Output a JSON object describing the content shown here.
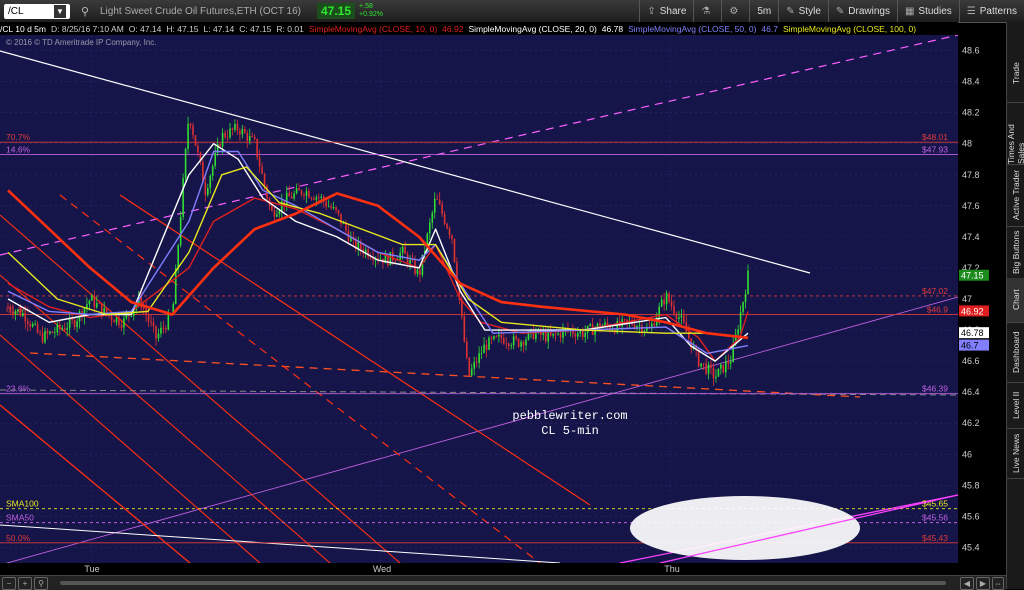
{
  "toolbar": {
    "symbol": "/CL",
    "description": "Light Sweet Crude Oil Futures,ETH (OCT 16)",
    "last": "47.15",
    "change_abs": "+.58",
    "change_pct": "+0.92%",
    "buttons": [
      {
        "icon": "share-icon",
        "glyph": "⇪",
        "label": "Share"
      },
      {
        "icon": "flask-icon",
        "glyph": "⚗",
        "label": ""
      },
      {
        "icon": "gear-icon",
        "glyph": "⚙",
        "label": ""
      },
      {
        "icon": "",
        "glyph": "",
        "label": "5m"
      },
      {
        "icon": "style-icon",
        "glyph": "✎",
        "label": "Style"
      },
      {
        "icon": "drawings-icon",
        "glyph": "✎",
        "label": "Drawings"
      },
      {
        "icon": "studies-icon",
        "glyph": "▦",
        "label": "Studies"
      },
      {
        "icon": "patterns-icon",
        "glyph": "☰",
        "label": "Patterns"
      }
    ]
  },
  "infobar": [
    {
      "text": "/CL 10 d 5m",
      "color": "#ffffff"
    },
    {
      "text": "D: 8/25/16 7:10 AM",
      "color": "#cccccc"
    },
    {
      "text": "O: 47.14",
      "color": "#cccccc"
    },
    {
      "text": "H: 47.15",
      "color": "#cccccc"
    },
    {
      "text": "L: 47.14",
      "color": "#cccccc"
    },
    {
      "text": "C: 47.15",
      "color": "#cccccc"
    },
    {
      "text": "R: 0.01",
      "color": "#cccccc"
    },
    {
      "text": "SimpleMovingAvg (CLOSE, 10, 0)",
      "color": "#e02020"
    },
    {
      "text": "46.92",
      "color": "#e02020"
    },
    {
      "text": "SimpleMovingAvg (CLOSE, 20, 0)",
      "color": "#ffffff"
    },
    {
      "text": "46.78",
      "color": "#ffffff"
    },
    {
      "text": "SimpleMovingAvg (CLOSE, 50, 0)",
      "color": "#8080ff"
    },
    {
      "text": "46.7",
      "color": "#8080ff"
    },
    {
      "text": "SimpleMovingAvg (CLOSE, 100, 0)",
      "color": "#e8e820"
    }
  ],
  "copyright": "© 2016 © TD Ameritrade IP Company, Inc.",
  "side_tabs": [
    "Trade",
    "Times And Sales",
    "Active Trader",
    "Big Buttons",
    "Chart",
    "Dashboard",
    "Level II",
    "Live News"
  ],
  "chart_data": {
    "type": "candlestick",
    "symbol": "/CL",
    "interval": "5m",
    "ylim": [
      45.3,
      48.7
    ],
    "y_ticks": [
      45.4,
      45.6,
      45.8,
      46,
      46.2,
      46.4,
      46.6,
      46.8,
      47,
      47.2,
      47.4,
      47.6,
      47.8,
      48,
      48.2,
      48.4,
      48.6
    ],
    "x_labels": [
      "Tue",
      "Wed",
      "Thu"
    ],
    "watermark": [
      "pebblewriter.com",
      "CL 5-min"
    ],
    "price_path": [
      [
        0,
        46.95
      ],
      [
        4,
        46.9
      ],
      [
        8,
        46.75
      ],
      [
        12,
        46.8
      ],
      [
        16,
        46.85
      ],
      [
        20,
        47.0
      ],
      [
        24,
        46.9
      ],
      [
        28,
        46.85
      ],
      [
        32,
        47.0
      ],
      [
        36,
        46.75
      ],
      [
        40,
        46.9
      ],
      [
        44,
        48.2
      ],
      [
        48,
        47.7
      ],
      [
        52,
        48.05
      ],
      [
        56,
        48.1
      ],
      [
        60,
        48.0
      ],
      [
        64,
        47.55
      ],
      [
        68,
        47.65
      ],
      [
        72,
        47.7
      ],
      [
        76,
        47.65
      ],
      [
        80,
        47.55
      ],
      [
        84,
        47.35
      ],
      [
        88,
        47.3
      ],
      [
        92,
        47.25
      ],
      [
        96,
        47.3
      ],
      [
        100,
        47.15
      ],
      [
        104,
        47.65
      ],
      [
        108,
        47.4
      ],
      [
        112,
        46.5
      ],
      [
        116,
        46.7
      ],
      [
        120,
        46.75
      ],
      [
        124,
        46.72
      ],
      [
        128,
        46.78
      ],
      [
        132,
        46.75
      ],
      [
        136,
        46.8
      ],
      [
        140,
        46.78
      ],
      [
        144,
        46.83
      ],
      [
        148,
        46.82
      ],
      [
        152,
        46.85
      ],
      [
        156,
        46.8
      ],
      [
        160,
        47.02
      ],
      [
        164,
        46.85
      ],
      [
        168,
        46.6
      ],
      [
        172,
        46.5
      ],
      [
        176,
        46.62
      ],
      [
        180,
        47.15
      ]
    ],
    "x_domain": [
      0,
      180
    ],
    "sma": [
      {
        "name": "SMA10",
        "color": "#e02020",
        "last": "46.92",
        "points": [
          [
            0,
            47.1
          ],
          [
            10,
            46.95
          ],
          [
            20,
            46.88
          ],
          [
            30,
            46.92
          ],
          [
            44,
            47.2
          ],
          [
            50,
            47.5
          ],
          [
            60,
            47.65
          ],
          [
            70,
            47.58
          ],
          [
            80,
            47.45
          ],
          [
            90,
            47.3
          ],
          [
            100,
            47.2
          ],
          [
            104,
            47.35
          ],
          [
            110,
            47.0
          ],
          [
            115,
            46.85
          ],
          [
            125,
            46.78
          ],
          [
            140,
            46.8
          ],
          [
            160,
            46.9
          ],
          [
            168,
            46.75
          ],
          [
            172,
            46.6
          ],
          [
            178,
            46.75
          ],
          [
            180,
            46.92
          ]
        ]
      },
      {
        "name": "SMA20",
        "color": "#ffffff",
        "last": "46.78",
        "points": [
          [
            0,
            47.0
          ],
          [
            10,
            46.85
          ],
          [
            20,
            46.9
          ],
          [
            30,
            46.9
          ],
          [
            44,
            47.8
          ],
          [
            50,
            48.0
          ],
          [
            56,
            47.9
          ],
          [
            62,
            47.65
          ],
          [
            70,
            47.5
          ],
          [
            80,
            47.4
          ],
          [
            90,
            47.25
          ],
          [
            100,
            47.2
          ],
          [
            104,
            47.45
          ],
          [
            110,
            47.05
          ],
          [
            116,
            46.8
          ],
          [
            140,
            46.8
          ],
          [
            160,
            46.88
          ],
          [
            166,
            46.7
          ],
          [
            172,
            46.6
          ],
          [
            180,
            46.78
          ]
        ]
      },
      {
        "name": "SMA50",
        "color": "#8080ff",
        "last": "46.7",
        "points": [
          [
            0,
            47.05
          ],
          [
            10,
            46.92
          ],
          [
            20,
            46.9
          ],
          [
            30,
            46.92
          ],
          [
            44,
            47.5
          ],
          [
            50,
            47.95
          ],
          [
            56,
            47.95
          ],
          [
            62,
            47.7
          ],
          [
            70,
            47.6
          ],
          [
            80,
            47.45
          ],
          [
            90,
            47.3
          ],
          [
            100,
            47.25
          ],
          [
            104,
            47.35
          ],
          [
            110,
            47.1
          ],
          [
            118,
            46.78
          ],
          [
            140,
            46.8
          ],
          [
            160,
            46.82
          ],
          [
            170,
            46.65
          ],
          [
            180,
            46.7
          ]
        ]
      },
      {
        "name": "SMA100",
        "color": "#e8e820",
        "last": "",
        "points": [
          [
            0,
            47.3
          ],
          [
            12,
            47.0
          ],
          [
            24,
            46.9
          ],
          [
            34,
            46.92
          ],
          [
            44,
            47.3
          ],
          [
            52,
            47.8
          ],
          [
            58,
            47.85
          ],
          [
            66,
            47.62
          ],
          [
            76,
            47.55
          ],
          [
            86,
            47.45
          ],
          [
            96,
            47.35
          ],
          [
            104,
            47.35
          ],
          [
            112,
            47.0
          ],
          [
            120,
            46.85
          ],
          [
            140,
            46.8
          ],
          [
            160,
            46.78
          ],
          [
            170,
            46.78
          ],
          [
            180,
            46.75
          ]
        ]
      },
      {
        "name": "SMA-red-thick",
        "color": "#ff3010",
        "last": "",
        "points": [
          [
            0,
            47.7
          ],
          [
            10,
            47.45
          ],
          [
            20,
            47.2
          ],
          [
            30,
            46.98
          ],
          [
            40,
            46.9
          ],
          [
            50,
            47.2
          ],
          [
            60,
            47.45
          ],
          [
            70,
            47.55
          ],
          [
            80,
            47.68
          ],
          [
            90,
            47.6
          ],
          [
            100,
            47.4
          ],
          [
            110,
            47.1
          ],
          [
            120,
            46.98
          ],
          [
            130,
            46.95
          ],
          [
            150,
            46.9
          ],
          [
            160,
            46.85
          ],
          [
            170,
            46.78
          ],
          [
            180,
            46.75
          ]
        ]
      }
    ],
    "fib_levels": [
      {
        "label": "70.7%",
        "value": 48.01,
        "tag": "$48.01",
        "color": "#e03a3a"
      },
      {
        "label": "14.6%",
        "value": 47.93,
        "tag": "$47.93",
        "color": "#c060e0"
      },
      {
        "label": "",
        "value": 47.02,
        "tag": "$47.02",
        "color": "#e03a3a",
        "dashed": true
      },
      {
        "label": "61.8%",
        "value": 46.9,
        "tag": "$46.9",
        "color": "#e03a3a"
      },
      {
        "label": "23.6%",
        "value": 46.39,
        "tag": "$46.39",
        "color": "#c060e0"
      },
      {
        "label": "SMA100",
        "value": 45.65,
        "tag": "$45.65",
        "color": "#e8e820",
        "dashed": true
      },
      {
        "label": "SMA50",
        "value": 45.56,
        "tag": "$45.56",
        "color": "#c060e0",
        "dashed": true
      },
      {
        "label": "50.0%",
        "value": 45.43,
        "tag": "$45.43",
        "color": "#e03a3a"
      }
    ],
    "axis_tags": [
      {
        "value": 47.15,
        "text": "47.15",
        "bg": "#1c8a1c",
        "fg": "#ffffff"
      },
      {
        "value": 46.92,
        "text": "46.92",
        "bg": "#e02020",
        "fg": "#ffffff"
      },
      {
        "value": 46.78,
        "text": "46.78",
        "bg": "#ffffff",
        "fg": "#000000"
      },
      {
        "value": 46.7,
        "text": "46.7",
        "bg": "#8080ff",
        "fg": "#000000"
      }
    ]
  }
}
